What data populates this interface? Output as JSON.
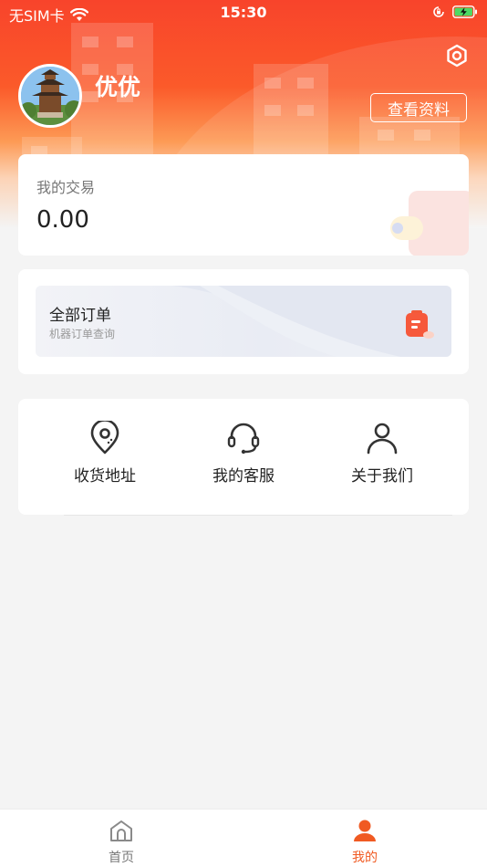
{
  "status_bar": {
    "carrier": "无SIM卡",
    "time": "15:30",
    "icons": [
      "wifi-icon",
      "orientation-lock-icon",
      "battery-charging-icon"
    ]
  },
  "profile": {
    "username": "优优",
    "view_profile_label": "查看资料",
    "settings_icon": "gear-icon"
  },
  "trade": {
    "label": "我的交易",
    "amount": "0.00"
  },
  "orders": {
    "title": "全部订单",
    "subtitle": "机器订单查询"
  },
  "services": [
    {
      "label": "收货地址",
      "icon": "location-pin-icon"
    },
    {
      "label": "我的客服",
      "icon": "headset-icon"
    },
    {
      "label": "关于我们",
      "icon": "person-icon"
    }
  ],
  "tabbar": {
    "items": [
      {
        "label": "首页",
        "icon": "home-icon"
      },
      {
        "label": "我的",
        "icon": "user-icon"
      }
    ],
    "active_index": 1
  },
  "colors": {
    "brand": "#f4442b",
    "accent": "#f05a22",
    "background": "#f4f4f4"
  }
}
